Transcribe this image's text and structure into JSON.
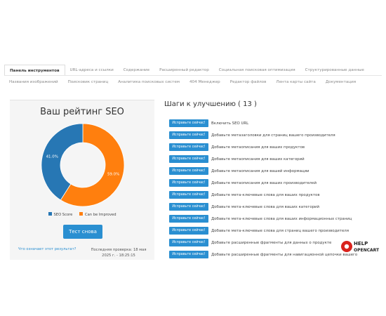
{
  "tabs": {
    "row1": [
      {
        "label": "Панель инструментов",
        "active": true
      },
      {
        "label": "URL-адреса и ссылки"
      },
      {
        "label": "Содержание"
      },
      {
        "label": "Расширенный редактор"
      },
      {
        "label": "Социальная поисковая оптимизация"
      },
      {
        "label": "Структурированные данные"
      }
    ],
    "row2": [
      {
        "label": "Названия изображений"
      },
      {
        "label": "Поисковик страниц"
      },
      {
        "label": "Аналитика поисковых систем"
      },
      {
        "label": "404 Менеджер"
      },
      {
        "label": "Редактор файлов"
      },
      {
        "label": "Лента карты сайта"
      },
      {
        "label": "Документация"
      }
    ]
  },
  "score": {
    "title": "Ваш рейтинг SEO",
    "seo_score_label": "41.0%",
    "improve_label": "59.0%",
    "legend_seo": "SEO Score",
    "legend_improve": "Can be Improved",
    "retest_button": "Тест снова",
    "what_means_link": "Что означает этот результат?",
    "last_check": "Последняя проверка: 18 мая 2025 г. - 18:25:15"
  },
  "chart_data": {
    "type": "pie",
    "categories": [
      "SEO Score",
      "Can be Improved"
    ],
    "values": [
      41.0,
      59.0
    ],
    "colors": [
      "#2777b4",
      "#ff7f0e"
    ],
    "title": "",
    "legend": "bottom"
  },
  "steps": {
    "title": "Шаги к улучшению ( 13 )",
    "fix_label": "Исправьте сейчас!",
    "items": [
      "Включить SEO URL",
      "Добавьте метазаголовки для страниц вашего производителя",
      "Добавьте метаописания для ваших продуктов",
      "Добавьте метаописания для ваших категорий",
      "Добавьте метаописания для вашей информации",
      "Добавьте метаописания для ваших производителей",
      "Добавьте мета-ключевые слова для ваших продуктов",
      "Добавьте мета-ключевые слова для ваших категорий",
      "Добавьте мета-ключевые слова для ваших информационных страниц",
      "Добавьте мета-ключевые слова для страниц вашего производителя",
      "Добавьте расширенные фрагменты для данных о продукте",
      "Добавьте расширенные фрагменты для навигационной цепочки вашего"
    ]
  },
  "logo": {
    "line1": "HELP",
    "line2": "OPENCART"
  }
}
